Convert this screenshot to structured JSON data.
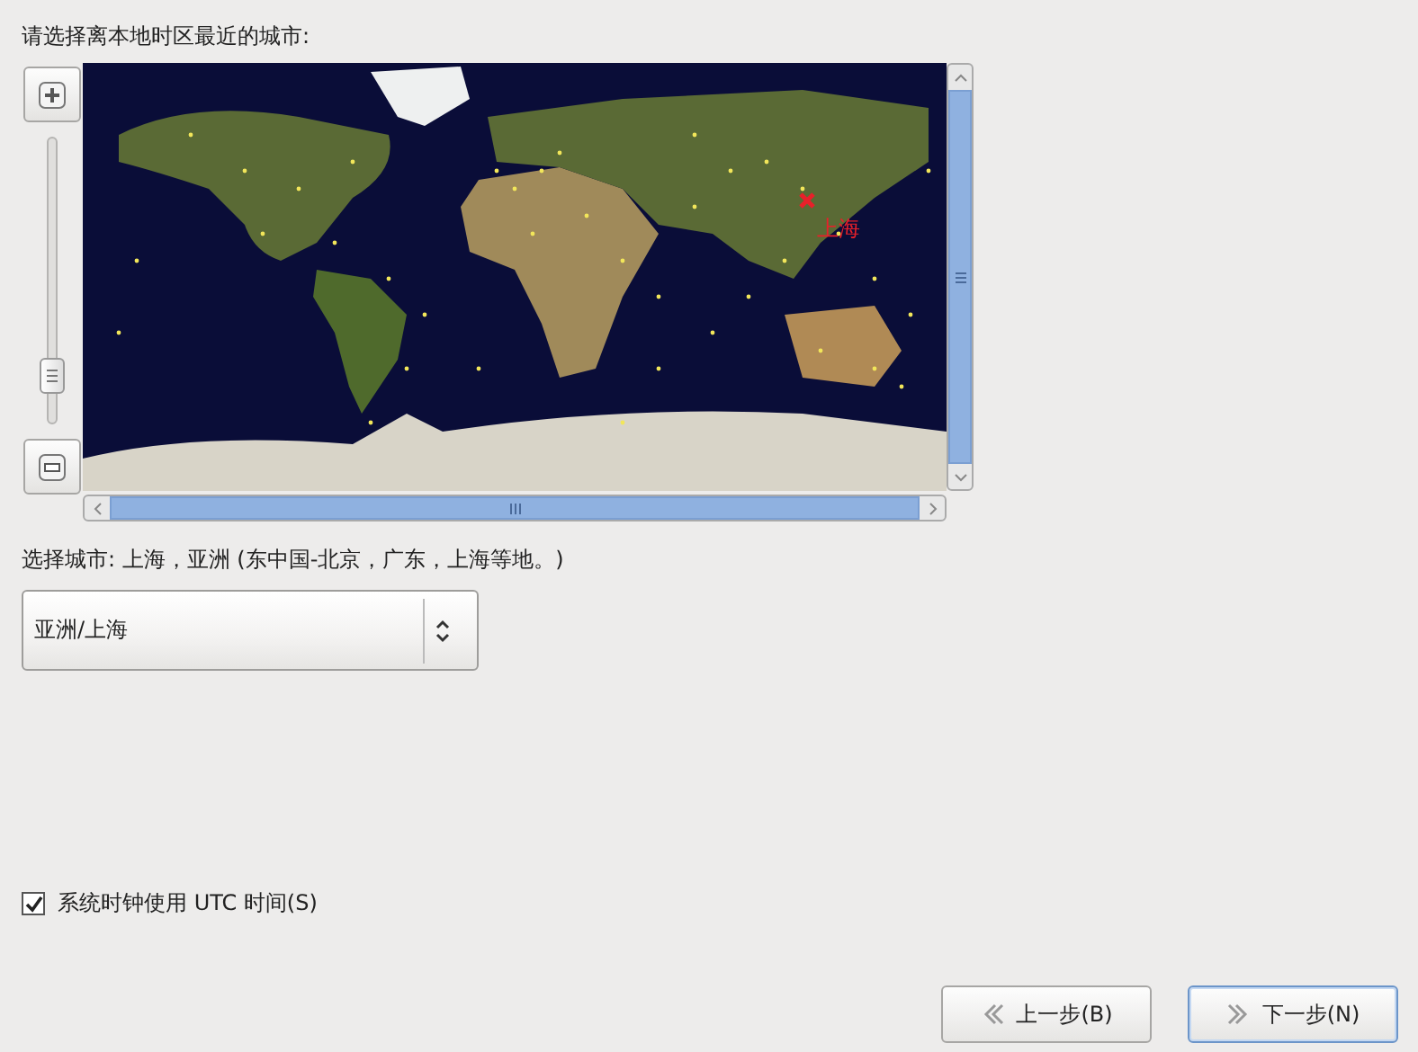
{
  "prompt": "请选择离本地时区最近的城市:",
  "zoom_slider": {
    "level": 0.1
  },
  "map": {
    "marker_label": "上海"
  },
  "selected_city_label": "选择城市: 上海，亚洲 (东中国-北京，广东，上海等地。)",
  "timezone_select": {
    "value": "亚洲/上海"
  },
  "utc_checkbox": {
    "label": "系统时钟使用 UTC 时间(S)",
    "checked": true
  },
  "buttons": [
    {
      "label": "上一步(B)",
      "kind": "back",
      "selected": false
    },
    {
      "label": "下一步(N)",
      "kind": "next",
      "selected": true
    }
  ]
}
